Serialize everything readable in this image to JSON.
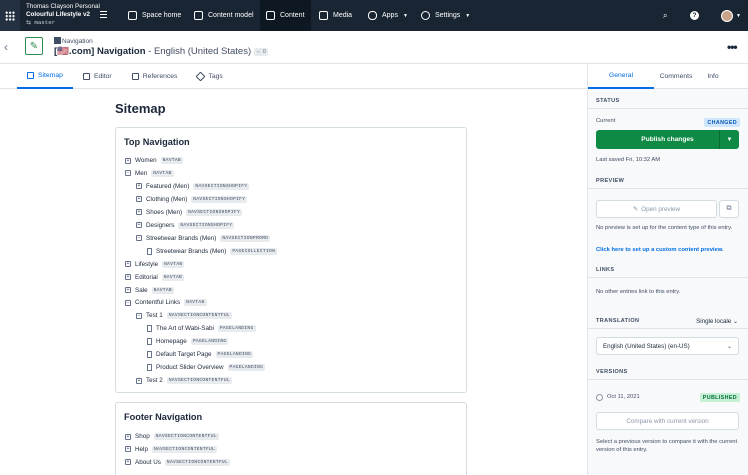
{
  "topbar": {
    "space_owner": "Thomas Clayson Personal",
    "space_name": "Colourful Lifestyle v2",
    "environment": "master",
    "nav": [
      {
        "label": "Space home",
        "icon": "home-icon"
      },
      {
        "label": "Content model",
        "icon": "cube-icon"
      },
      {
        "label": "Content",
        "icon": "edit-icon",
        "active": true
      },
      {
        "label": "Media",
        "icon": "image-icon"
      },
      {
        "label": "Apps",
        "icon": "puzzle-icon",
        "dropdown": true
      },
      {
        "label": "Settings",
        "icon": "gear-icon",
        "dropdown": true
      }
    ],
    "search_icon": "search-icon",
    "help_label": "?"
  },
  "header": {
    "content_type": "Navigation",
    "title": "[🇺🇸.com] Navigation",
    "locale": "- English (United States)",
    "count_badge": "0",
    "back_icon": "arrow-left-icon",
    "more_icon": "dots-icon"
  },
  "tabs": [
    {
      "label": "Sitemap",
      "active": true
    },
    {
      "label": "Editor"
    },
    {
      "label": "References"
    },
    {
      "label": "Tags"
    }
  ],
  "main": {
    "heading": "Sitemap",
    "top_nav": {
      "title": "Top Navigation",
      "nodes": [
        {
          "label": "Women",
          "tag": "NAVTAB",
          "level": 0,
          "kind": "plus"
        },
        {
          "label": "Men",
          "tag": "NAVTAB",
          "level": 0,
          "kind": "minus"
        },
        {
          "label": "Featured (Men)",
          "tag": "NAVSECTIONSHOPIFY",
          "level": 1,
          "kind": "plus"
        },
        {
          "label": "Clothing (Men)",
          "tag": "NAVSECTIONSHOPIFY",
          "level": 1,
          "kind": "plus"
        },
        {
          "label": "Shoes (Men)",
          "tag": "NAVSECTIONSHOPIFY",
          "level": 1,
          "kind": "plus"
        },
        {
          "label": "Designers",
          "tag": "NAVSECTIONSHOPIFY",
          "level": 1,
          "kind": "plus"
        },
        {
          "label": "Streetwear Brands (Men)",
          "tag": "NAVSECTIONPROMO",
          "level": 1,
          "kind": "minus"
        },
        {
          "label": "Streetwear Brands (Men)",
          "tag": "PAGECOLLECTION",
          "level": 2,
          "kind": "doc"
        },
        {
          "label": "Lifestyle",
          "tag": "NAVTAB",
          "level": 0,
          "kind": "plus"
        },
        {
          "label": "Editorial",
          "tag": "NAVTAB",
          "level": 0,
          "kind": "plus"
        },
        {
          "label": "Sale",
          "tag": "NAVTAB",
          "level": 0,
          "kind": "plus"
        },
        {
          "label": "Contentful Links",
          "tag": "NAVTAB",
          "level": 0,
          "kind": "minus"
        },
        {
          "label": "Test 1",
          "tag": "NAVSECTIONCONTENTFUL",
          "level": 1,
          "kind": "minus"
        },
        {
          "label": "The Art of Wabi-Sabi",
          "tag": "PAGELANDING",
          "level": 2,
          "kind": "doc"
        },
        {
          "label": "Homepage",
          "tag": "PAGELANDING",
          "level": 2,
          "kind": "doc"
        },
        {
          "label": "Default Target Page",
          "tag": "PAGELANDING",
          "level": 2,
          "kind": "doc"
        },
        {
          "label": "Product Slider Overview",
          "tag": "PAGELANDING",
          "level": 2,
          "kind": "doc"
        },
        {
          "label": "Test 2",
          "tag": "NAVSECTIONCONTENTFUL",
          "level": 1,
          "kind": "plus"
        }
      ]
    },
    "footer_nav": {
      "title": "Footer Navigation",
      "nodes": [
        {
          "label": "Shop",
          "tag": "NAVSECTIONCONTENTFUL",
          "level": 0,
          "kind": "plus"
        },
        {
          "label": "Help",
          "tag": "NAVSECTIONCONTENTFUL",
          "level": 0,
          "kind": "plus"
        },
        {
          "label": "About Us",
          "tag": "NAVSECTIONCONTENTFUL",
          "level": 0,
          "kind": "plus"
        }
      ]
    }
  },
  "sidebar": {
    "tabs": [
      "General",
      "Comments",
      "Info"
    ],
    "status_label": "STATUS",
    "current_label": "Current",
    "current_badge": "CHANGED",
    "publish_label": "Publish changes",
    "last_saved": "Last saved Fri, 10:32 AM",
    "preview_label": "PREVIEW",
    "open_preview_label": "Open preview",
    "preview_note": "No preview is set up for the content type of this entry.",
    "preview_link": "Click here to set up a custom content preview.",
    "links_label": "LINKS",
    "links_note": "No other entries link to this entry.",
    "translation_label": "TRANSLATION",
    "single_locale": "Single locale",
    "locale_value": "English (United States) (en-US)",
    "versions_label": "VERSIONS",
    "version_date": "Oct 11, 2021",
    "version_badge": "PUBLISHED",
    "compare_label": "Compare with current version",
    "versions_note": "Select a previous version to compare it with the current version of this entry."
  }
}
